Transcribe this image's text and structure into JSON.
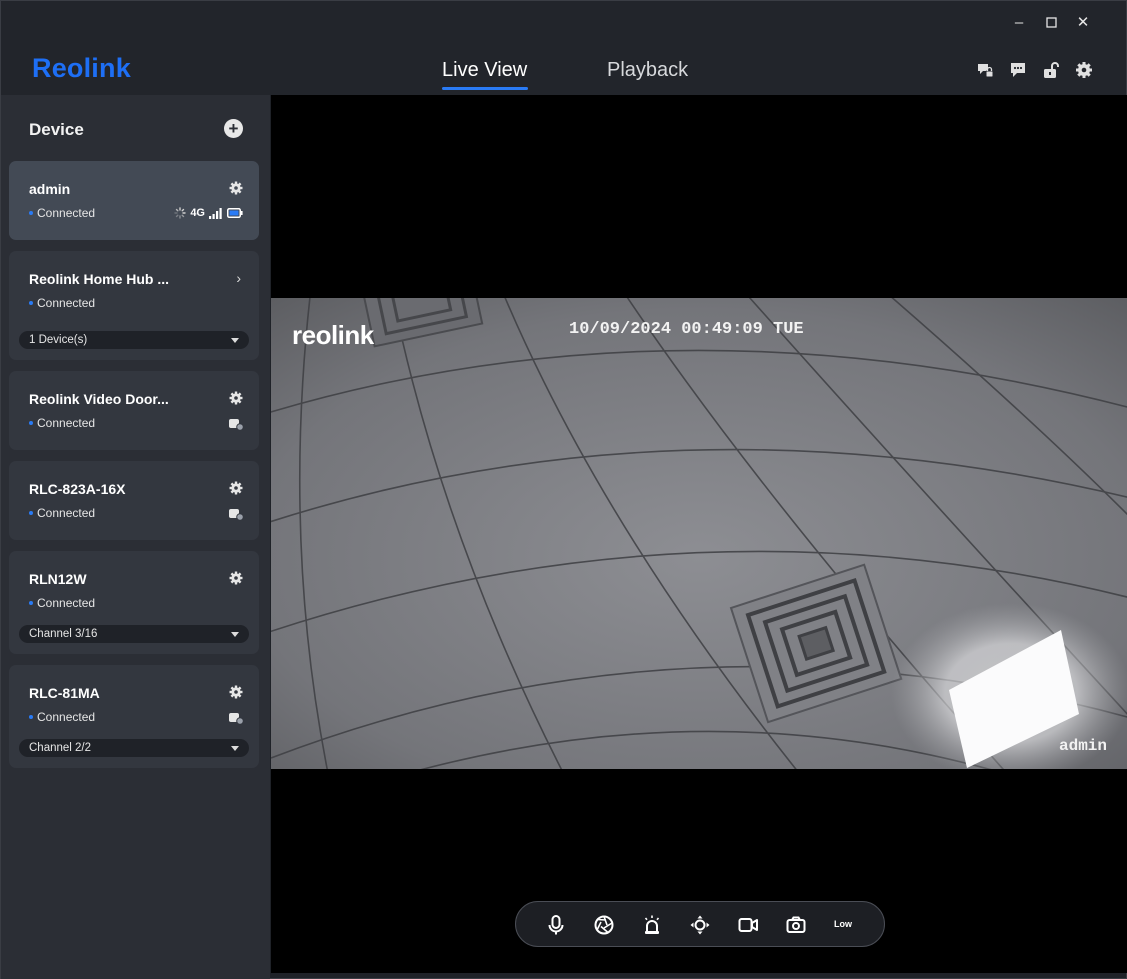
{
  "window": {
    "minimize": "–",
    "maximize": "☐",
    "close": "✕"
  },
  "header": {
    "logo": "Reolink",
    "tabs": [
      {
        "label": "Live View",
        "active": true
      },
      {
        "label": "Playback",
        "active": false
      }
    ],
    "icons": [
      "message-lock-icon",
      "chat-icon",
      "unlock-icon",
      "gear-icon"
    ]
  },
  "sidebar": {
    "title": "Device",
    "add_icon": "+",
    "devices": [
      {
        "name": "admin",
        "status": "Connected",
        "network": "4G",
        "selected": true
      },
      {
        "name": "Reolink Home Hub ...",
        "status": "Connected",
        "dropdown": "1 Device(s)"
      },
      {
        "name": "Reolink Video Door...",
        "status": "Connected"
      },
      {
        "name": "RLC-823A-16X",
        "status": "Connected"
      },
      {
        "name": "RLN12W",
        "status": "Connected",
        "dropdown": "Channel 3/16"
      },
      {
        "name": "RLC-81MA",
        "status": "Connected",
        "dropdown": "Channel 2/2"
      }
    ]
  },
  "video": {
    "osd_logo": "reolink",
    "osd_timestamp": "10/09/2024 00:49:09 TUE",
    "osd_user": "admin",
    "toolbar": {
      "buttons": [
        "microphone-icon",
        "aperture-icon",
        "siren-icon",
        "ptz-icon",
        "record-icon",
        "snapshot-icon"
      ],
      "quality": "Low"
    }
  },
  "colors": {
    "accent": "#2a7bf5",
    "logo": "#1e6ff5",
    "sidebar_bg": "#2b2e35",
    "card_bg": "#33373f",
    "card_selected_bg": "#434a55"
  }
}
